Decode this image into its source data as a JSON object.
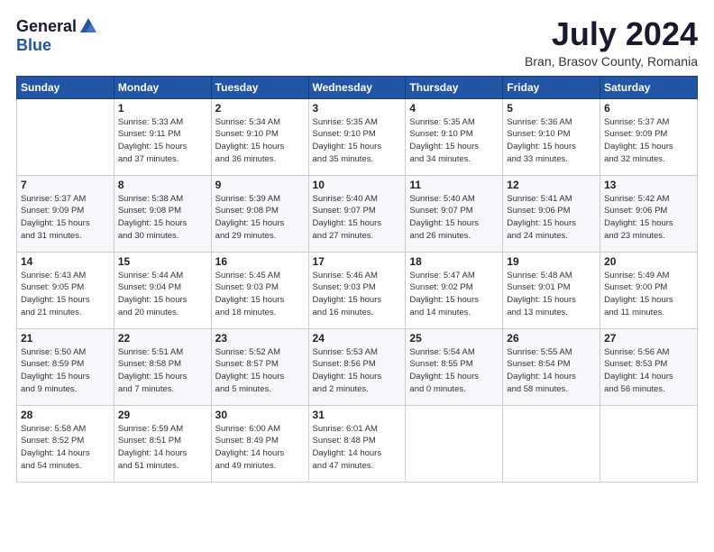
{
  "header": {
    "logo_general": "General",
    "logo_blue": "Blue",
    "month_year": "July 2024",
    "location": "Bran, Brasov County, Romania"
  },
  "days_of_week": [
    "Sunday",
    "Monday",
    "Tuesday",
    "Wednesday",
    "Thursday",
    "Friday",
    "Saturday"
  ],
  "weeks": [
    [
      {
        "day": "",
        "info": ""
      },
      {
        "day": "1",
        "info": "Sunrise: 5:33 AM\nSunset: 9:11 PM\nDaylight: 15 hours\nand 37 minutes."
      },
      {
        "day": "2",
        "info": "Sunrise: 5:34 AM\nSunset: 9:10 PM\nDaylight: 15 hours\nand 36 minutes."
      },
      {
        "day": "3",
        "info": "Sunrise: 5:35 AM\nSunset: 9:10 PM\nDaylight: 15 hours\nand 35 minutes."
      },
      {
        "day": "4",
        "info": "Sunrise: 5:35 AM\nSunset: 9:10 PM\nDaylight: 15 hours\nand 34 minutes."
      },
      {
        "day": "5",
        "info": "Sunrise: 5:36 AM\nSunset: 9:10 PM\nDaylight: 15 hours\nand 33 minutes."
      },
      {
        "day": "6",
        "info": "Sunrise: 5:37 AM\nSunset: 9:09 PM\nDaylight: 15 hours\nand 32 minutes."
      }
    ],
    [
      {
        "day": "7",
        "info": "Sunrise: 5:37 AM\nSunset: 9:09 PM\nDaylight: 15 hours\nand 31 minutes."
      },
      {
        "day": "8",
        "info": "Sunrise: 5:38 AM\nSunset: 9:08 PM\nDaylight: 15 hours\nand 30 minutes."
      },
      {
        "day": "9",
        "info": "Sunrise: 5:39 AM\nSunset: 9:08 PM\nDaylight: 15 hours\nand 29 minutes."
      },
      {
        "day": "10",
        "info": "Sunrise: 5:40 AM\nSunset: 9:07 PM\nDaylight: 15 hours\nand 27 minutes."
      },
      {
        "day": "11",
        "info": "Sunrise: 5:40 AM\nSunset: 9:07 PM\nDaylight: 15 hours\nand 26 minutes."
      },
      {
        "day": "12",
        "info": "Sunrise: 5:41 AM\nSunset: 9:06 PM\nDaylight: 15 hours\nand 24 minutes."
      },
      {
        "day": "13",
        "info": "Sunrise: 5:42 AM\nSunset: 9:06 PM\nDaylight: 15 hours\nand 23 minutes."
      }
    ],
    [
      {
        "day": "14",
        "info": "Sunrise: 5:43 AM\nSunset: 9:05 PM\nDaylight: 15 hours\nand 21 minutes."
      },
      {
        "day": "15",
        "info": "Sunrise: 5:44 AM\nSunset: 9:04 PM\nDaylight: 15 hours\nand 20 minutes."
      },
      {
        "day": "16",
        "info": "Sunrise: 5:45 AM\nSunset: 9:03 PM\nDaylight: 15 hours\nand 18 minutes."
      },
      {
        "day": "17",
        "info": "Sunrise: 5:46 AM\nSunset: 9:03 PM\nDaylight: 15 hours\nand 16 minutes."
      },
      {
        "day": "18",
        "info": "Sunrise: 5:47 AM\nSunset: 9:02 PM\nDaylight: 15 hours\nand 14 minutes."
      },
      {
        "day": "19",
        "info": "Sunrise: 5:48 AM\nSunset: 9:01 PM\nDaylight: 15 hours\nand 13 minutes."
      },
      {
        "day": "20",
        "info": "Sunrise: 5:49 AM\nSunset: 9:00 PM\nDaylight: 15 hours\nand 11 minutes."
      }
    ],
    [
      {
        "day": "21",
        "info": "Sunrise: 5:50 AM\nSunset: 8:59 PM\nDaylight: 15 hours\nand 9 minutes."
      },
      {
        "day": "22",
        "info": "Sunrise: 5:51 AM\nSunset: 8:58 PM\nDaylight: 15 hours\nand 7 minutes."
      },
      {
        "day": "23",
        "info": "Sunrise: 5:52 AM\nSunset: 8:57 PM\nDaylight: 15 hours\nand 5 minutes."
      },
      {
        "day": "24",
        "info": "Sunrise: 5:53 AM\nSunset: 8:56 PM\nDaylight: 15 hours\nand 2 minutes."
      },
      {
        "day": "25",
        "info": "Sunrise: 5:54 AM\nSunset: 8:55 PM\nDaylight: 15 hours\nand 0 minutes."
      },
      {
        "day": "26",
        "info": "Sunrise: 5:55 AM\nSunset: 8:54 PM\nDaylight: 14 hours\nand 58 minutes."
      },
      {
        "day": "27",
        "info": "Sunrise: 5:56 AM\nSunset: 8:53 PM\nDaylight: 14 hours\nand 56 minutes."
      }
    ],
    [
      {
        "day": "28",
        "info": "Sunrise: 5:58 AM\nSunset: 8:52 PM\nDaylight: 14 hours\nand 54 minutes."
      },
      {
        "day": "29",
        "info": "Sunrise: 5:59 AM\nSunset: 8:51 PM\nDaylight: 14 hours\nand 51 minutes."
      },
      {
        "day": "30",
        "info": "Sunrise: 6:00 AM\nSunset: 8:49 PM\nDaylight: 14 hours\nand 49 minutes."
      },
      {
        "day": "31",
        "info": "Sunrise: 6:01 AM\nSunset: 8:48 PM\nDaylight: 14 hours\nand 47 minutes."
      },
      {
        "day": "",
        "info": ""
      },
      {
        "day": "",
        "info": ""
      },
      {
        "day": "",
        "info": ""
      }
    ]
  ]
}
